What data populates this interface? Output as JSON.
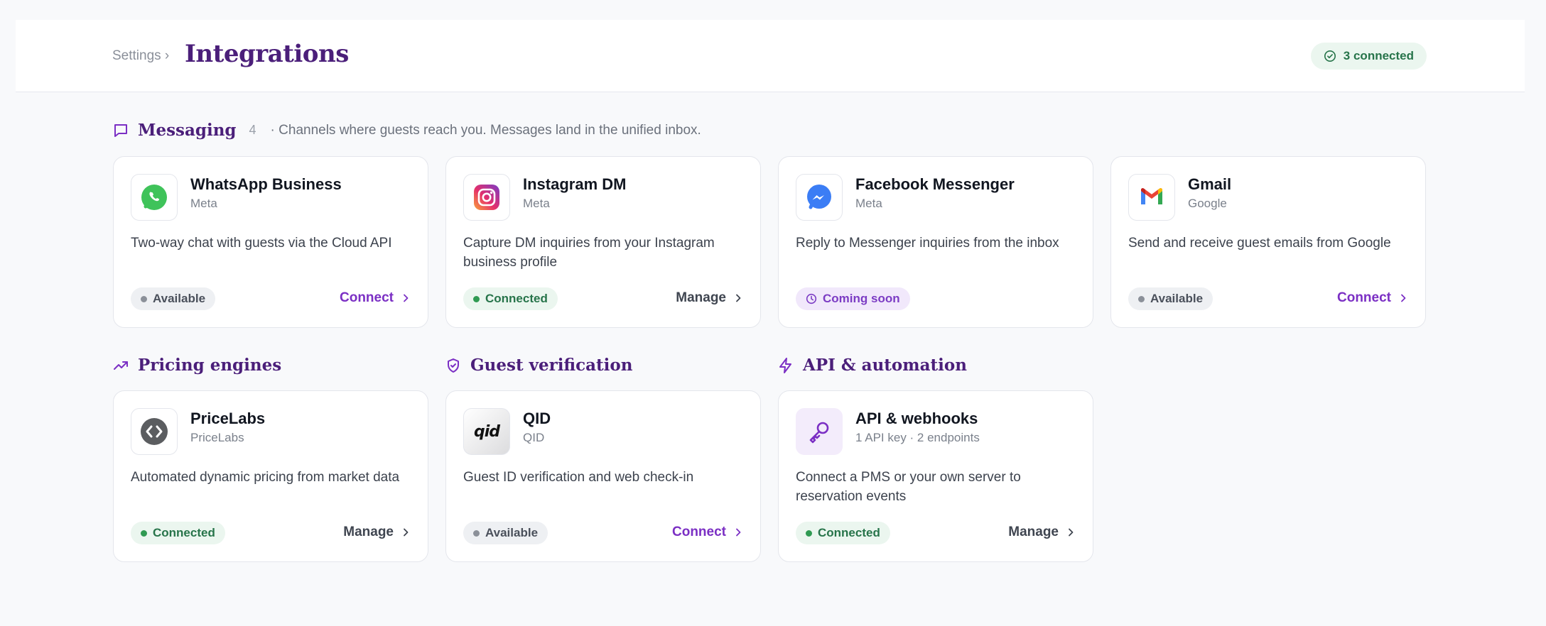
{
  "header": {
    "breadcrumb": "Settings ›",
    "title": "Integrations",
    "connected_pill": "3 connected"
  },
  "sections": {
    "messaging": {
      "title": "Messaging",
      "count": "4",
      "description": "· Channels where guests reach you. Messages land in the unified inbox.",
      "icon": "chat-bubble-icon"
    },
    "pricing": {
      "title": "Pricing engines",
      "icon": "trending-up-icon"
    },
    "verification": {
      "title": "Guest verification",
      "icon": "shield-check-icon"
    },
    "api": {
      "title": "API & automation",
      "icon": "lightning-icon"
    }
  },
  "cards": {
    "whatsapp": {
      "name": "WhatsApp Business",
      "vendor": "Meta",
      "description": "Two-way chat with guests via the Cloud API",
      "status": "Available",
      "action": "Connect",
      "icon": "whatsapp-icon"
    },
    "instagram": {
      "name": "Instagram DM",
      "vendor": "Meta",
      "description": "Capture DM inquiries from your Instagram business profile",
      "status": "Connected",
      "action": "Manage",
      "icon": "instagram-icon"
    },
    "messenger": {
      "name": "Facebook Messenger",
      "vendor": "Meta",
      "description": "Reply to Messenger inquiries from the inbox",
      "status": "Coming soon",
      "icon": "messenger-icon"
    },
    "gmail": {
      "name": "Gmail",
      "vendor": "Google",
      "description": "Send and receive guest emails from Google",
      "status": "Available",
      "action": "Connect",
      "icon": "gmail-icon"
    },
    "pricelabs": {
      "name": "PriceLabs",
      "vendor": "PriceLabs",
      "description": "Automated dynamic pricing from market data",
      "status": "Connected",
      "action": "Manage",
      "icon": "pricelabs-icon"
    },
    "qid": {
      "name": "QID",
      "vendor": "QID",
      "logo_text": "qid",
      "description": "Guest ID verification and web check-in",
      "status": "Available",
      "action": "Connect",
      "icon": "qid-icon"
    },
    "api": {
      "name": "API & webhooks",
      "vendor": "1 API key · 2 endpoints",
      "description": "Connect a PMS or your own server to reservation events",
      "status": "Connected",
      "action": "Manage",
      "icon": "key-icon"
    }
  },
  "colors": {
    "brand_purple": "#4b1f7a",
    "accent_purple": "#7b2fc4",
    "connected_green": "#2f9a52",
    "available_gray": "#8b9099"
  }
}
